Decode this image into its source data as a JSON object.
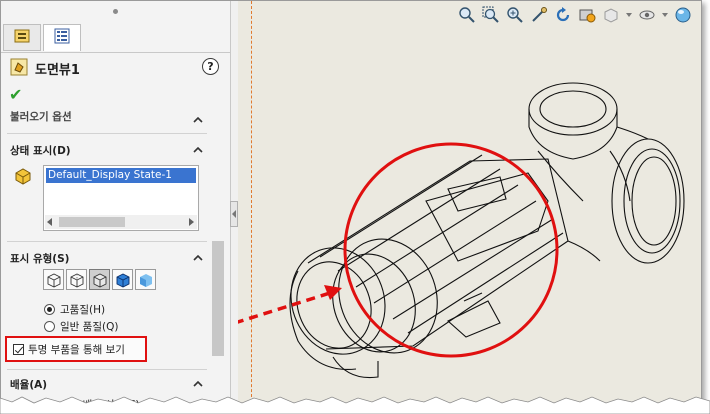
{
  "property_manager": {
    "title": "도면뷰1",
    "help_glyph": "?",
    "ok_glyph": "✔",
    "cropped_section": "불러오기 옵션",
    "display_state": {
      "header": "상태 표시(D)",
      "selected_item": "Default_Display State-1"
    },
    "display_style": {
      "header": "표시 유형(S)",
      "quality_high": "고품질(H)",
      "quality_draft": "일반 품질(Q)",
      "selected_quality": "고품질(H)"
    },
    "transparency_checkbox": {
      "label": "투명 부품을 통해 보기",
      "checked": true
    },
    "scale_section": {
      "header": "배율(A)",
      "cropped_option": "시트 배율 사용(E)"
    }
  },
  "toolbar": {
    "icons": [
      "zoom-to-fit-icon",
      "zoom-to-area-icon",
      "zoom-in-out-icon",
      "select-icon",
      "rotate-icon",
      "hide-show-icon",
      "display-style-icon",
      "view-setting-icon",
      "appearance-icon"
    ]
  },
  "colors": {
    "highlight_red": "#e01010",
    "selection_blue": "#3a74d0",
    "ok_green": "#2ea02e",
    "canvas": "#ebe9e0"
  }
}
